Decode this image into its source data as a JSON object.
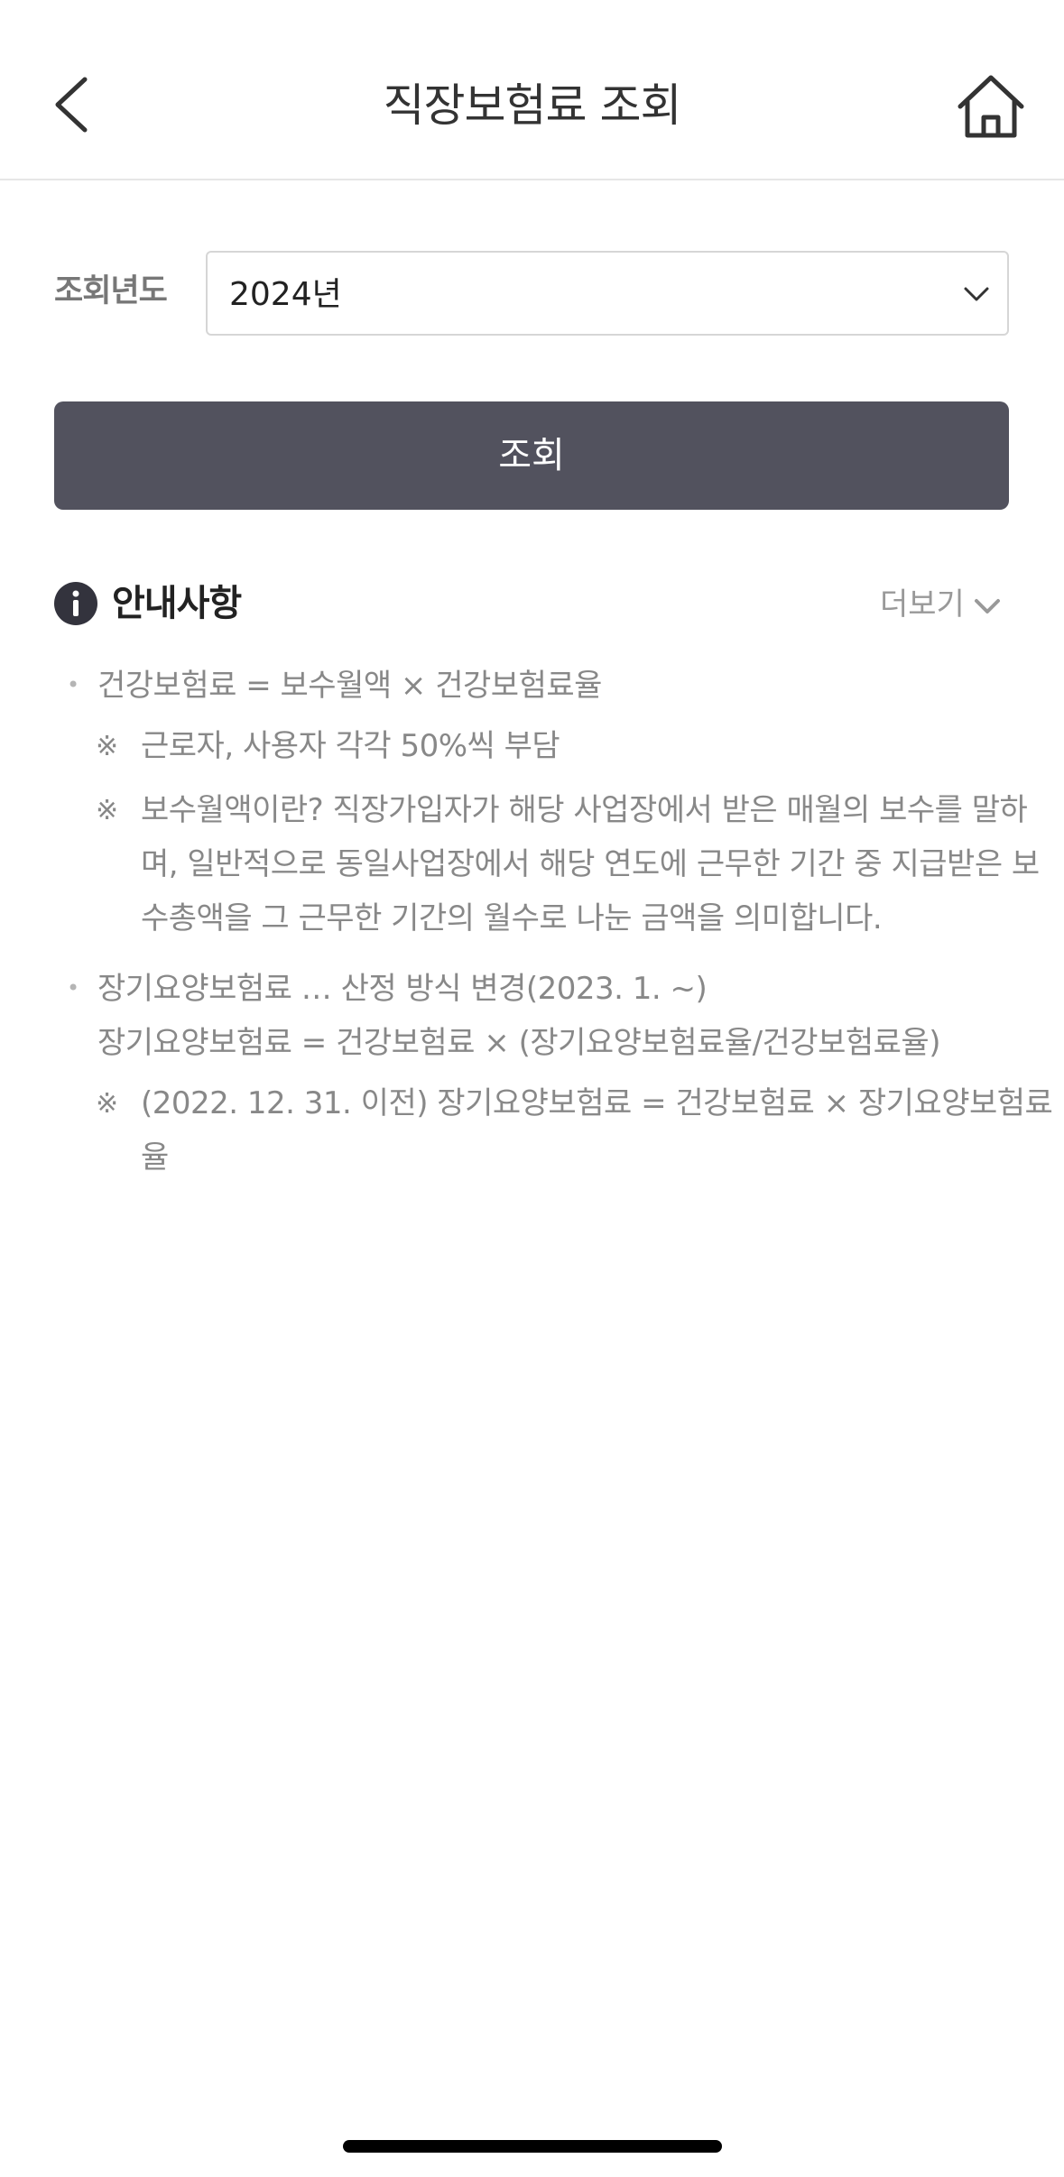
{
  "header": {
    "title": "직장보험료 조회"
  },
  "form": {
    "year_label": "조회년도",
    "year_value": "2024년",
    "search_label": "조회"
  },
  "notice": {
    "title": "안내사항",
    "more_label": "더보기",
    "items": [
      {
        "text": "건강보험료 = 보수월액 × 건강보험료율",
        "subs": [
          {
            "mark": "※",
            "lines": [
              "근로자, 사용자 각각 50%씩 부담"
            ]
          },
          {
            "mark": "※",
            "lines": [
              "보수월액이란? 직장가입자가 해당 사업장에서 받은 매월의 보수를 말하",
              "며, 일반적으로 동일사업장에서 해당 연도에 근무한 기간 중 지급받은 보",
              "수총액을 그 근무한 기간의 월수로 나눈 금액을 의미합니다."
            ]
          }
        ]
      },
      {
        "lines": [
          "장기요양보험료 … 산정 방식 변경(2023. 1. ~)",
          "장기요양보험료 = 건강보험료 × (장기요양보험료율/건강보험료율)"
        ],
        "subs": [
          {
            "mark": "※",
            "lines": [
              "(2022. 12. 31. 이전) 장기요양보험료 = 건강보험료 × 장기요양보험료",
              "율"
            ]
          }
        ]
      }
    ]
  },
  "icons": {
    "back": "chevron-left-icon",
    "home": "home-icon",
    "info": "info-icon",
    "dropdown": "chevron-down-icon"
  }
}
